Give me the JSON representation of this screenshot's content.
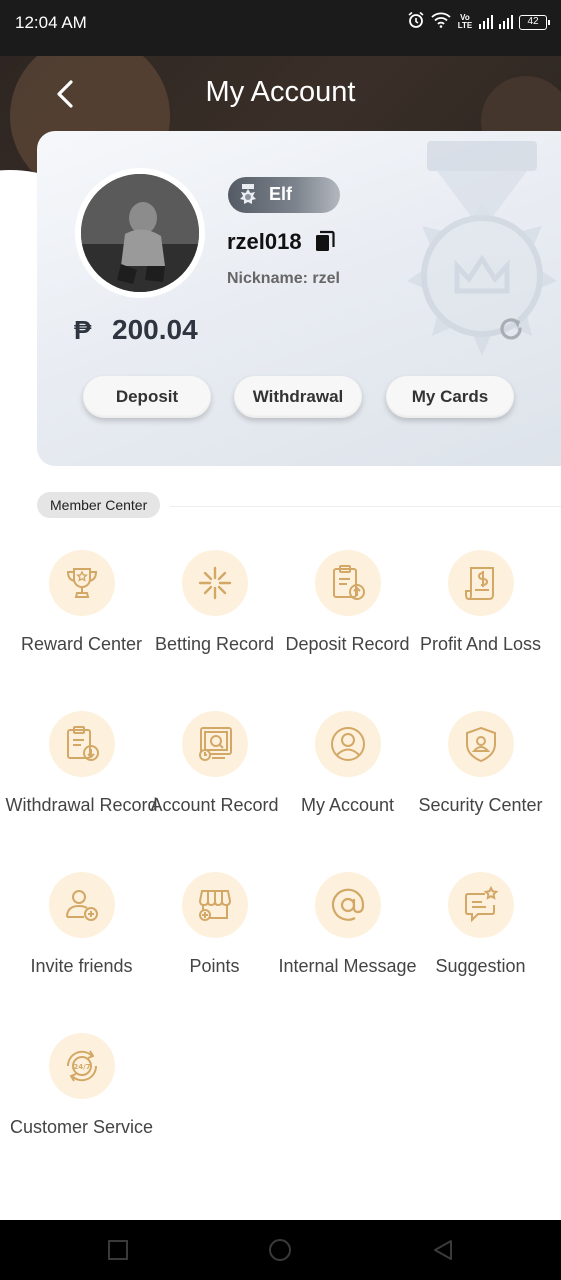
{
  "status_bar": {
    "time": "12:04 AM",
    "battery": "42",
    "volte": "Vo LTE"
  },
  "header": {
    "title": "My Account"
  },
  "profile": {
    "level": "Elf",
    "username": "rzel018",
    "nickname": "Nickname: rzel",
    "currency_symbol": "₱",
    "balance": "200.04"
  },
  "actions": {
    "deposit": "Deposit",
    "withdrawal": "Withdrawal",
    "my_cards": "My Cards"
  },
  "member_center": {
    "label": "Member Center",
    "items": [
      {
        "label": "Reward Center",
        "icon": "trophy-icon"
      },
      {
        "label": "Betting Record",
        "icon": "sparkle-icon"
      },
      {
        "label": "Deposit Record",
        "icon": "clipboard-upload-icon"
      },
      {
        "label": "Profit And Loss",
        "icon": "invoice-dollar-icon"
      },
      {
        "label": "Withdrawal Record",
        "icon": "clipboard-download-icon"
      },
      {
        "label": "Account Record",
        "icon": "monitor-record-icon"
      },
      {
        "label": "My Account",
        "icon": "user-circle-icon"
      },
      {
        "label": "Security Center",
        "icon": "shield-user-icon"
      },
      {
        "label": "Invite friends",
        "icon": "user-add-icon"
      },
      {
        "label": "Points",
        "icon": "store-icon"
      },
      {
        "label": "Internal Message",
        "icon": "at-sign-icon"
      },
      {
        "label": "Suggestion",
        "icon": "chat-star-icon"
      },
      {
        "label": "Customer Service",
        "icon": "support-24-7-icon"
      }
    ]
  },
  "colors": {
    "header_bg": "#2e2622",
    "icon_circle": "#fdf1dd",
    "icon_stroke": "#d3a867"
  }
}
